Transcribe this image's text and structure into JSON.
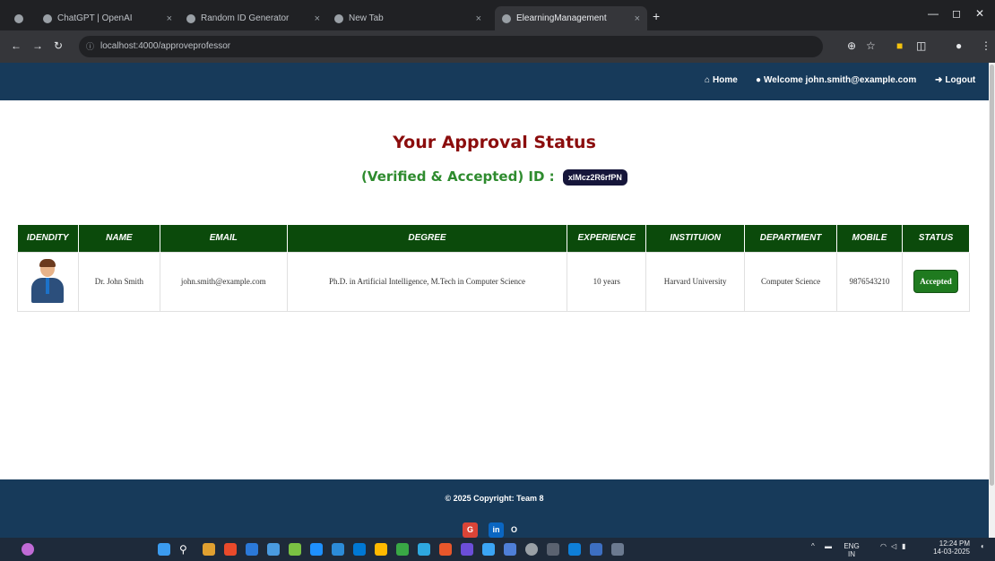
{
  "browser": {
    "tabs": [
      {
        "title": "ChatGPT | OpenAI",
        "active": false
      },
      {
        "title": "Random ID Generator",
        "active": false
      },
      {
        "title": "New Tab",
        "active": false
      },
      {
        "title": "ElearningManagement",
        "active": true
      }
    ],
    "url": "localhost:4000/approveprofessor"
  },
  "nav": {
    "home": "Home",
    "welcome": "Welcome john.smith@example.com",
    "logout": "Logout"
  },
  "main": {
    "title": "Your Approval Status",
    "status_label": "(Verified & Accepted) ID :",
    "id_value": "xIMcz2R6rfPN"
  },
  "table": {
    "headers": [
      "IDENDITY",
      "NAME",
      "EMAIL",
      "DEGREE",
      "EXPERIENCE",
      "INSTITUION",
      "DEPARTMENT",
      "MOBILE",
      "STATUS"
    ],
    "row": {
      "name": "Dr. John Smith",
      "email": "john.smith@example.com",
      "degree": "Ph.D. in Artificial Intelligence, M.Tech in Computer Science",
      "experience": "10 years",
      "institution": "Harvard University",
      "department": "Computer Science",
      "mobile": "9876543210",
      "status": "Accepted"
    }
  },
  "footer": {
    "copyright": "© 2025 Copyright: Team 8",
    "social": [
      "G",
      "in",
      "O"
    ]
  },
  "taskbar": {
    "lang": "ENG IN",
    "time": "12:24 PM",
    "date": "14-03-2025"
  },
  "colors": {
    "nav_bg": "#173a5a",
    "title": "#8b0d0d",
    "status_green": "#2e8b2e",
    "table_header": "#0b4a0b",
    "accepted_btn": "#1f7a1f"
  }
}
